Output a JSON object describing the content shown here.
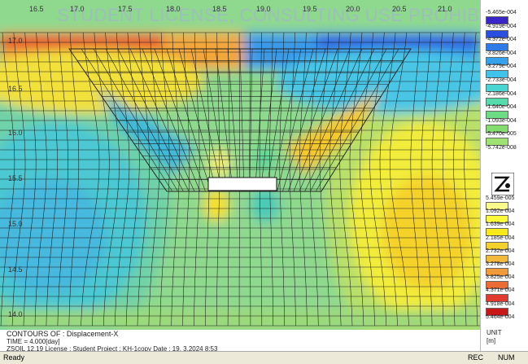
{
  "watermark": "STUDENT LICENSE, CONSULTING USE PROHIBITE",
  "x_ticks": [
    "16.5",
    "17.0",
    "17.5",
    "18.0",
    "18.5",
    "19.0",
    "19.5",
    "20.0",
    "20.5",
    "21.0"
  ],
  "y_ticks": [
    "17.0",
    "16.5",
    "16.0",
    "15.5",
    "15.0",
    "14.5",
    "14.0"
  ],
  "info": {
    "contours": "CONTOURS OF : Displacement-X",
    "time": "TIME = 4.000[day]",
    "license": "ZSOIL 12.19   License : Student   Project : KH-1copy     Date : 19. 3.2024    8:53"
  },
  "legend": {
    "negative": [
      "-5.465e-004",
      "-4.919e-004",
      "-4.372e-004",
      "-3.826e-004",
      "-3.279e-004",
      "-2.733e-004",
      "-2.186e-004",
      "-1.640e-004",
      "-1.093e-004",
      "-5.470e-005",
      "-5.742e-008"
    ],
    "positive": [
      "5.459e-005",
      "1.092e-004",
      "1.639e-004",
      "2.185e-004",
      "2.732e-004",
      "3.278e-004",
      "3.825e-004",
      "4.371e-004",
      "4.918e-004",
      "5.464e-004"
    ],
    "neg_colors": [
      "#3a26c8",
      "#2a4fe0",
      "#2e7be8",
      "#34a2ec",
      "#40c2ea",
      "#48d6d2",
      "#56dcac",
      "#6bdc84",
      "#82dc6e",
      "#9ee272"
    ],
    "pos_colors": [
      "#fafa8a",
      "#fafa3a",
      "#f8ea1a",
      "#f4d02a",
      "#f2b83a",
      "#f09a3a",
      "#ec6a34",
      "#e23a2e",
      "#c81818",
      "#b85a1a"
    ],
    "logo_icon": "zsoil-logo-icon",
    "unit_label": "UNIT",
    "unit_value": "[m]"
  },
  "status": {
    "left": "Ready",
    "rec": "REC",
    "num": "NUM"
  }
}
